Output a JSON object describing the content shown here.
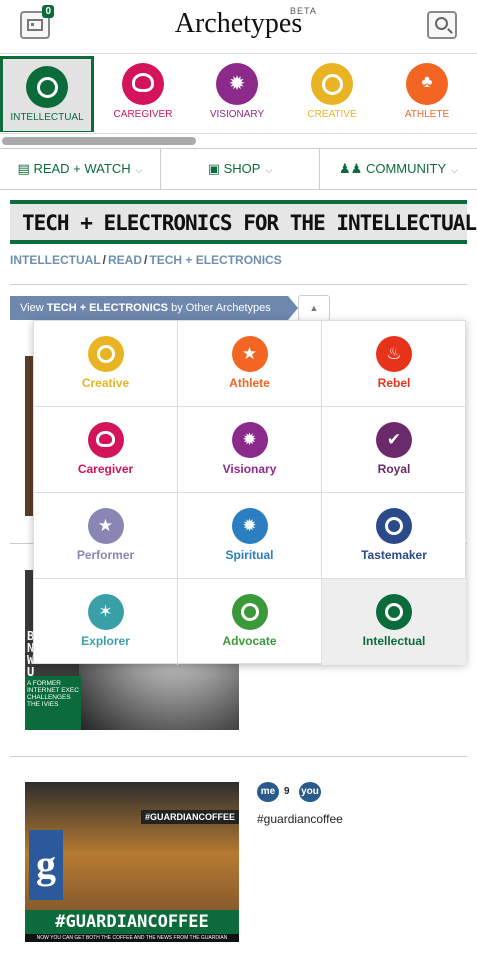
{
  "header": {
    "logo": "Archetypes",
    "beta": "BETA",
    "profile_badge": "0",
    "profile_icon": "profile-card-icon",
    "search_icon": "search-icon"
  },
  "archetype_strip": [
    {
      "label": "INTELLECTUAL",
      "color": "#0b6b3a",
      "active": true
    },
    {
      "label": "CAREGIVER",
      "color": "#d4145a"
    },
    {
      "label": "VISIONARY",
      "color": "#8b2a8a"
    },
    {
      "label": "CREATIVE",
      "color": "#e8b423"
    },
    {
      "label": "ATHLETE",
      "color": "#f26522"
    }
  ],
  "nav": [
    {
      "label": "READ + WATCH",
      "icon": "book-icon"
    },
    {
      "label": "SHOP",
      "icon": "bag-icon"
    },
    {
      "label": "COMMUNITY",
      "icon": "people-icon"
    }
  ],
  "page": {
    "title": "TECH + ELECTRONICS FOR THE INTELLECTUAL",
    "breadcrumb": [
      "INTELLECTUAL",
      "READ",
      "TECH + ELECTRONICS"
    ],
    "other_prefix": "View ",
    "other_strong": "TECH + ELECTRONICS",
    "other_suffix": " by Other Archetypes"
  },
  "dropdown": [
    {
      "label": "Creative",
      "color": "#e8b423"
    },
    {
      "label": "Athlete",
      "color": "#f26522"
    },
    {
      "label": "Rebel",
      "color": "#e8331c"
    },
    {
      "label": "Caregiver",
      "color": "#d4145a"
    },
    {
      "label": "Visionary",
      "color": "#8b2a8a"
    },
    {
      "label": "Royal",
      "color": "#6b2a6b"
    },
    {
      "label": "Performer",
      "color": "#8a86b4"
    },
    {
      "label": "Spiritual",
      "color": "#2a7ec1"
    },
    {
      "label": "Tastemaker",
      "color": "#2b4a8a"
    },
    {
      "label": "Explorer",
      "color": "#3aa0a8"
    },
    {
      "label": "Advocate",
      "color": "#3a9a3a"
    },
    {
      "label": "Intellectual",
      "color": "#0b6b3a",
      "active": true
    }
  ],
  "cards": {
    "card2_caption": "BEN NELSON'S WANNABE U",
    "card2_sub": "A FORMER INTERNET EXEC CHALLENGES THE IVIES",
    "card3_sign": "#GUARDIANCOFFEE",
    "card3_bar": "#GUARDIANCOFFEE",
    "card3_foot": "NOW YOU CAN GET BOTH THE COFFEE AND THE NEWS FROM THE GUARDIAN",
    "card3_letter": "g",
    "me": "me",
    "count": "9",
    "you": "you",
    "post_title": "#guardiancoffee"
  }
}
